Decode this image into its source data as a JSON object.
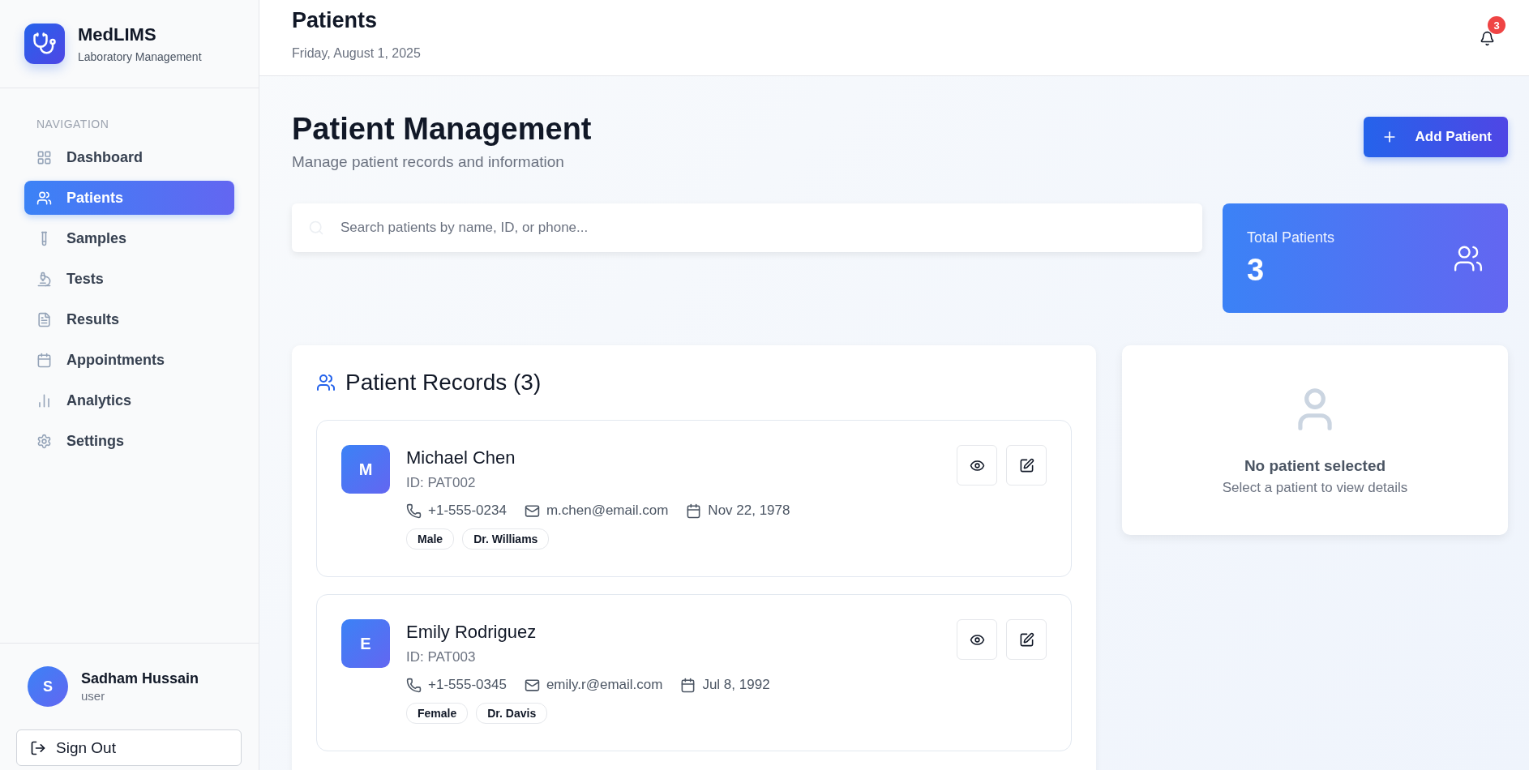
{
  "brand": {
    "name": "MedLIMS",
    "tagline": "Laboratory Management"
  },
  "sidebar": {
    "section_label": "NAVIGATION",
    "items": [
      {
        "label": "Dashboard",
        "selected": false
      },
      {
        "label": "Patients",
        "selected": true
      },
      {
        "label": "Samples",
        "selected": false
      },
      {
        "label": "Tests",
        "selected": false
      },
      {
        "label": "Results",
        "selected": false
      },
      {
        "label": "Appointments",
        "selected": false
      },
      {
        "label": "Analytics",
        "selected": false
      },
      {
        "label": "Settings",
        "selected": false
      }
    ]
  },
  "user": {
    "initial": "S",
    "name": "Sadham Hussain",
    "role": "user"
  },
  "sign_out": "Sign Out",
  "header": {
    "title": "Patients",
    "date": "Friday, August 1, 2025",
    "notification_count": "3"
  },
  "page": {
    "title": "Patient Management",
    "subtitle": "Manage patient records and information",
    "add_button": "Add Patient"
  },
  "search": {
    "placeholder": "Search patients by name, ID, or phone..."
  },
  "stat": {
    "label": "Total Patients",
    "value": "3"
  },
  "records": {
    "title": "Patient Records (3)",
    "patients": [
      {
        "initial": "M",
        "name": "Michael Chen",
        "id": "ID: PAT002",
        "phone": "+1-555-0234",
        "email": "m.chen@email.com",
        "dob": "Nov 22, 1978",
        "tags": [
          "Male",
          "Dr. Williams"
        ]
      },
      {
        "initial": "E",
        "name": "Emily Rodriguez",
        "id": "ID: PAT003",
        "phone": "+1-555-0345",
        "email": "emily.r@email.com",
        "dob": "Jul 8, 1992",
        "tags": [
          "Female",
          "Dr. Davis"
        ]
      }
    ]
  },
  "details": {
    "title": "No patient selected",
    "hint": "Select a patient to view details"
  }
}
